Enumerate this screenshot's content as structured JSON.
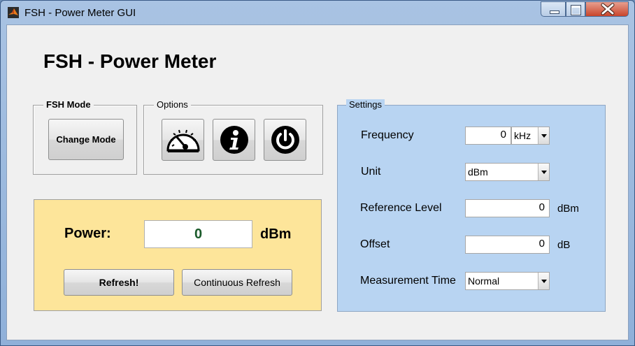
{
  "window": {
    "title": "FSH - Power Meter GUI"
  },
  "heading": "FSH - Power Meter",
  "fsh_mode": {
    "label": "FSH Mode",
    "button": "Change Mode"
  },
  "options": {
    "label": "Options",
    "icons": [
      "gauge-icon",
      "info-icon",
      "power-icon"
    ]
  },
  "power": {
    "label": "Power:",
    "value": "0",
    "unit": "dBm",
    "refresh_button": "Refresh!",
    "continuous_button": "Continuous Refresh"
  },
  "settings": {
    "label": "Settings",
    "frequency": {
      "label": "Frequency",
      "value": "0",
      "unit_selected": "kHz"
    },
    "unit": {
      "label": "Unit",
      "selected": "dBm"
    },
    "reference_level": {
      "label": "Reference Level",
      "value": "0",
      "unit": "dBm"
    },
    "offset": {
      "label": "Offset",
      "value": "0",
      "unit": "dB"
    },
    "measurement_time": {
      "label": "Measurement Time",
      "selected": "Normal"
    }
  },
  "colors": {
    "power_panel": "#fde59a",
    "settings_panel": "#b8d4f2",
    "power_value": "#1a5a2a"
  }
}
